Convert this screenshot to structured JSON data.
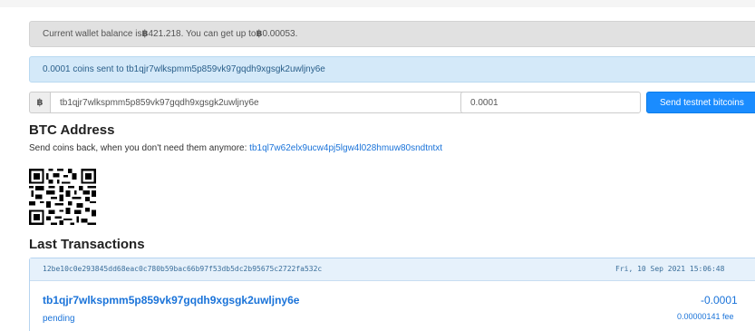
{
  "balance_alert": {
    "prefix": "Current wallet balance is ",
    "currency_symbol": "฿",
    "balance": " 421.218. You can get up to ",
    "currency_symbol_2": "฿",
    "max": " 0.00053."
  },
  "sent_alert": {
    "text": "0.0001 coins sent to tb1qjr7wlkspmm5p859vk97gqdh9xgsgk2uwljny6e"
  },
  "send_form": {
    "addon_symbol": "฿",
    "address_value": "tb1qjr7wlkspmm5p859vk97gqdh9xgsgk2uwljny6e",
    "amount_value": "0.0001",
    "send_label": "Send testnet bitcoins"
  },
  "btc_address": {
    "heading": "BTC Address",
    "sendback_text": "Send coins back, when you don't need them anymore: ",
    "address_link": "tb1ql7w62elx9ucw4pj5lgw4l028hmuw80sndtntxt"
  },
  "last_transactions": {
    "heading": "Last Transactions",
    "items": [
      {
        "hash": "12be10c0e293845dd68eac0c780b59bac66b97f53db5dc2b95675c2722fa532c",
        "date": "Fri, 10 Sep 2021 15:06:48",
        "address": "tb1qjr7wlkspmm5p859vk97gqdh9xgsgk2uwljny6e",
        "amount": "-0.0001",
        "status": "pending",
        "fee": "0.00000141 fee"
      }
    ]
  },
  "colors": {
    "primary": "#1a8cff",
    "link": "#1a73d9",
    "info_bg": "#d4e9f9",
    "muted_bg": "#e1e1e1"
  },
  "icons": {
    "qr": "qr-code-icon",
    "currency": "bitcoin-symbol-icon"
  }
}
